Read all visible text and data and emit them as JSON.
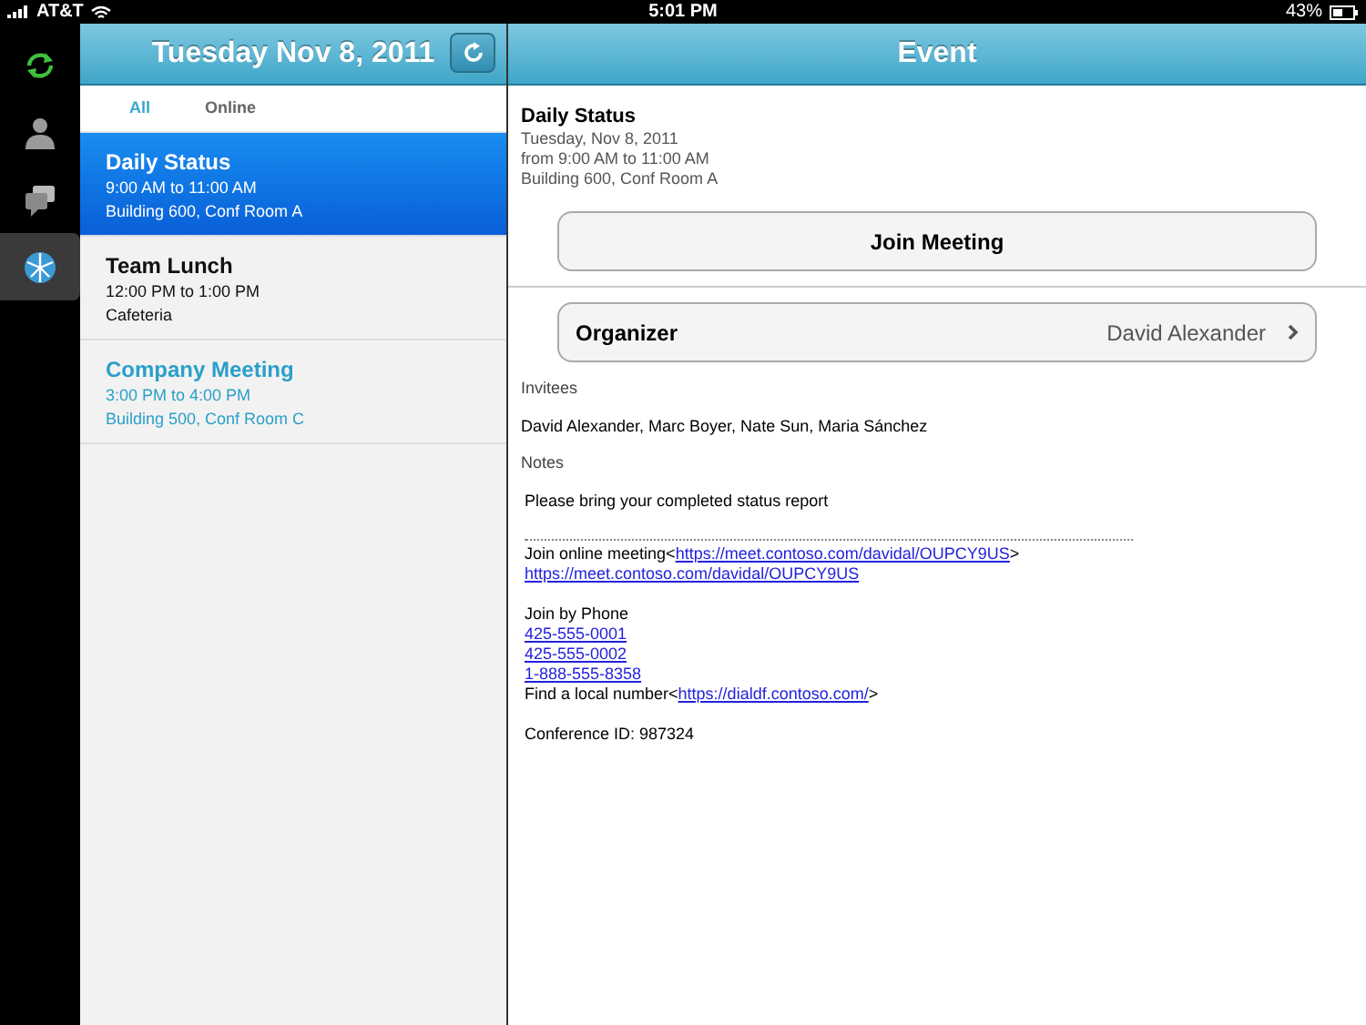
{
  "status_bar": {
    "carrier": "AT&T",
    "time": "5:01 PM",
    "battery": "43%"
  },
  "rail": [
    {
      "kind": "sync",
      "selected": false
    },
    {
      "kind": "person",
      "selected": false
    },
    {
      "kind": "chat",
      "selected": false
    },
    {
      "kind": "globe",
      "selected": true
    }
  ],
  "list_panel": {
    "title": "Tuesday Nov 8, 2011",
    "tabs": [
      {
        "label": "All",
        "selected": true
      },
      {
        "label": "Online",
        "selected": false
      }
    ],
    "events": [
      {
        "title": "Daily Status",
        "time": "9:00 AM to 11:00 AM",
        "place": "Building 600, Conf Room A",
        "selected": true,
        "color": "#ffffff"
      },
      {
        "title": "Team Lunch",
        "time": "12:00 PM to 1:00 PM",
        "place": "Cafeteria",
        "selected": false,
        "color": "#111111"
      },
      {
        "title": "Company Meeting",
        "time": "3:00 PM to 4:00 PM",
        "place": "Building 500, Conf Room C",
        "selected": false,
        "color": "#2a9fc9"
      }
    ]
  },
  "event_panel": {
    "title": "Event",
    "name": "Daily Status",
    "date": "Tuesday, Nov 8, 2011",
    "time": "from 9:00 AM to 11:00 AM",
    "place": "Building 600, Conf Room A",
    "join_button": "Join Meeting",
    "organizer_label": "Organizer",
    "organizer": "David Alexander",
    "invitees_label": "Invitees",
    "invitees": "David Alexander, Marc Boyer, Nate Sun, Maria Sánchez",
    "notes_label": "Notes",
    "notes": [
      {
        "kind": "line",
        "segments": [
          {
            "text": "Please bring your completed status report",
            "link": false
          }
        ]
      },
      {
        "kind": "gap"
      },
      {
        "kind": "rule"
      },
      {
        "kind": "line",
        "segments": [
          {
            "text": "Join online meeting<",
            "link": false
          },
          {
            "text": "https://meet.contoso.com/davidal/OUPCY9US",
            "link": true
          },
          {
            "text": ">",
            "link": false
          }
        ]
      },
      {
        "kind": "line",
        "segments": [
          {
            "text": "https://meet.contoso.com/davidal/OUPCY9US",
            "link": true
          }
        ]
      },
      {
        "kind": "gap"
      },
      {
        "kind": "line",
        "segments": [
          {
            "text": "Join by Phone",
            "link": false
          }
        ]
      },
      {
        "kind": "line",
        "segments": [
          {
            "text": "425-555-0001",
            "link": true
          }
        ]
      },
      {
        "kind": "line",
        "segments": [
          {
            "text": "425-555-0002",
            "link": true
          }
        ]
      },
      {
        "kind": "line",
        "segments": [
          {
            "text": "1-888-555-8358",
            "link": true
          }
        ]
      },
      {
        "kind": "line",
        "segments": [
          {
            "text": "Find a local number<",
            "link": false
          },
          {
            "text": "https://dialdf.contoso.com/",
            "link": true
          },
          {
            "text": ">",
            "link": false
          }
        ]
      },
      {
        "kind": "gap"
      },
      {
        "kind": "line",
        "segments": [
          {
            "text": "Conference ID: 987324",
            "link": false
          }
        ]
      }
    ]
  }
}
